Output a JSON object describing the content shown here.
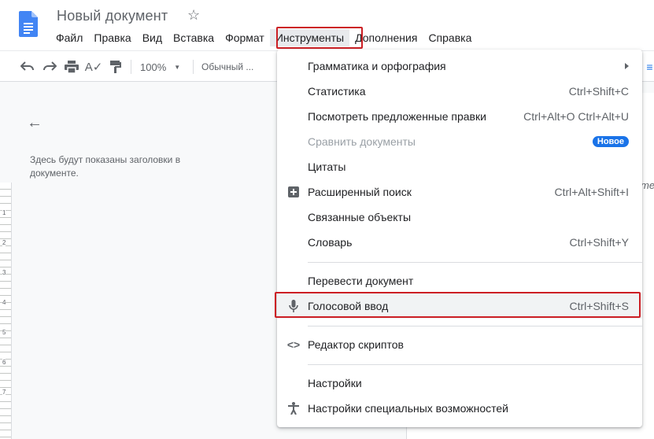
{
  "doc": {
    "title": "Новый документ"
  },
  "menubar": {
    "items": [
      "Файл",
      "Правка",
      "Вид",
      "Вставка",
      "Формат",
      "Инструменты",
      "Дополнения",
      "Справка"
    ]
  },
  "toolbar": {
    "zoom": "100%",
    "style": "Обычный ..."
  },
  "outline": {
    "placeholder": "Здесь будут показаны заголовки в документе."
  },
  "ruler": {
    "numbers": [
      "1",
      "2",
      "3",
      "4",
      "5",
      "6",
      "7"
    ]
  },
  "page": {
    "visible_char": "me"
  },
  "tools_menu": {
    "grammar": "Грамматика и орфография",
    "stats": {
      "label": "Статистика",
      "shortcut": "Ctrl+Shift+C"
    },
    "review": {
      "label": "Посмотреть предложенные правки",
      "shortcut": "Ctrl+Alt+O Ctrl+Alt+U"
    },
    "compare": {
      "label": "Сравнить документы",
      "badge": "Новое"
    },
    "citations": "Цитаты",
    "explore": {
      "label": "Расширенный поиск",
      "shortcut": "Ctrl+Alt+Shift+I"
    },
    "linked": "Связанные объекты",
    "dictionary": {
      "label": "Словарь",
      "shortcut": "Ctrl+Shift+Y"
    },
    "translate": "Перевести документ",
    "voice": {
      "label": "Голосовой ввод",
      "shortcut": "Ctrl+Shift+S"
    },
    "script": "Редактор скриптов",
    "preferences": "Настройки",
    "accessibility": "Настройки специальных возможностей"
  },
  "colors": {
    "highlight": "#cc1f24",
    "docs_blue": "#4285f4",
    "badge": "#1a73e8"
  }
}
